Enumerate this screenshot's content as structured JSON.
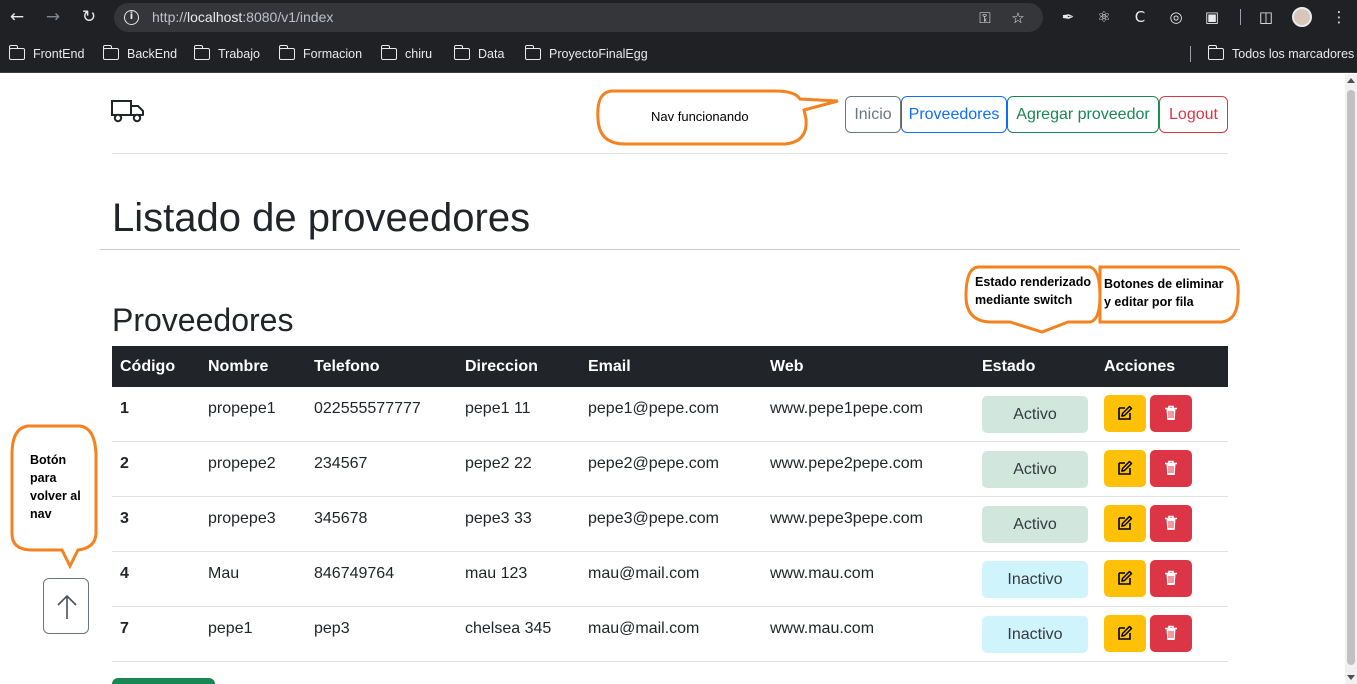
{
  "browser": {
    "url_prefix": "http://",
    "url_host": "localhost",
    "url_rest": ":8080/v1/index",
    "bookmarks": [
      "FrontEnd",
      "BackEnd",
      "Trabajo",
      "Formacion",
      "chiru",
      "Data",
      "ProyectoFinalEgg"
    ],
    "all_bookmarks": "Todos los marcadores"
  },
  "nav": {
    "inicio": "Inicio",
    "proveedores": "Proveedores",
    "agregar": "Agregar proveedor",
    "logout": "Logout"
  },
  "page": {
    "title": "Listado de proveedores",
    "section_title": "Proveedores"
  },
  "table": {
    "headers": [
      "Código",
      "Nombre",
      "Telefono",
      "Direccion",
      "Email",
      "Web",
      "Estado",
      "Acciones"
    ],
    "rows": [
      {
        "codigo": "1",
        "nombre": "propepe1",
        "telefono": "022555577777",
        "direccion": "pepe1 11",
        "email": "pepe1@pepe.com",
        "web": "www.pepe1pepe.com",
        "estado": "Activo"
      },
      {
        "codigo": "2",
        "nombre": "propepe2",
        "telefono": "234567",
        "direccion": "pepe2 22",
        "email": "pepe2@pepe.com",
        "web": "www.pepe2pepe.com",
        "estado": "Activo"
      },
      {
        "codigo": "3",
        "nombre": "propepe3",
        "telefono": "345678",
        "direccion": "pepe3 33",
        "email": "pepe3@pepe.com",
        "web": "www.pepe3pepe.com",
        "estado": "Activo"
      },
      {
        "codigo": "4",
        "nombre": "Mau",
        "telefono": "846749764",
        "direccion": "mau 123",
        "email": "mau@mail.com",
        "web": "www.mau.com",
        "estado": "Inactivo"
      },
      {
        "codigo": "7",
        "nombre": "pepe1",
        "telefono": "pep3",
        "direccion": "chelsea 345",
        "email": "mau@mail.com",
        "web": "www.mau.com",
        "estado": "Inactivo"
      }
    ]
  },
  "annotations": {
    "nav": "Nav funcionando",
    "estado_line1": "Estado renderizado",
    "estado_line2": "mediante switch",
    "botones_line1": "Botones de eliminar",
    "botones_line2": "y editar por fila",
    "back_line1": "Botón",
    "back_line2": "para",
    "back_line3": "volver al",
    "back_line4": "nav"
  },
  "colors": {
    "callout_border": "#f58220",
    "activo_bg": "#d1e7dd",
    "inactivo_bg": "#cff4fc",
    "edit_btn": "#ffc107",
    "delete_btn": "#dc3545",
    "table_header": "#212529"
  },
  "icons": {
    "edit": "pencil-square-icon",
    "delete": "trash-icon",
    "back_to_top": "arrow-up-icon",
    "logo": "truck-icon"
  }
}
